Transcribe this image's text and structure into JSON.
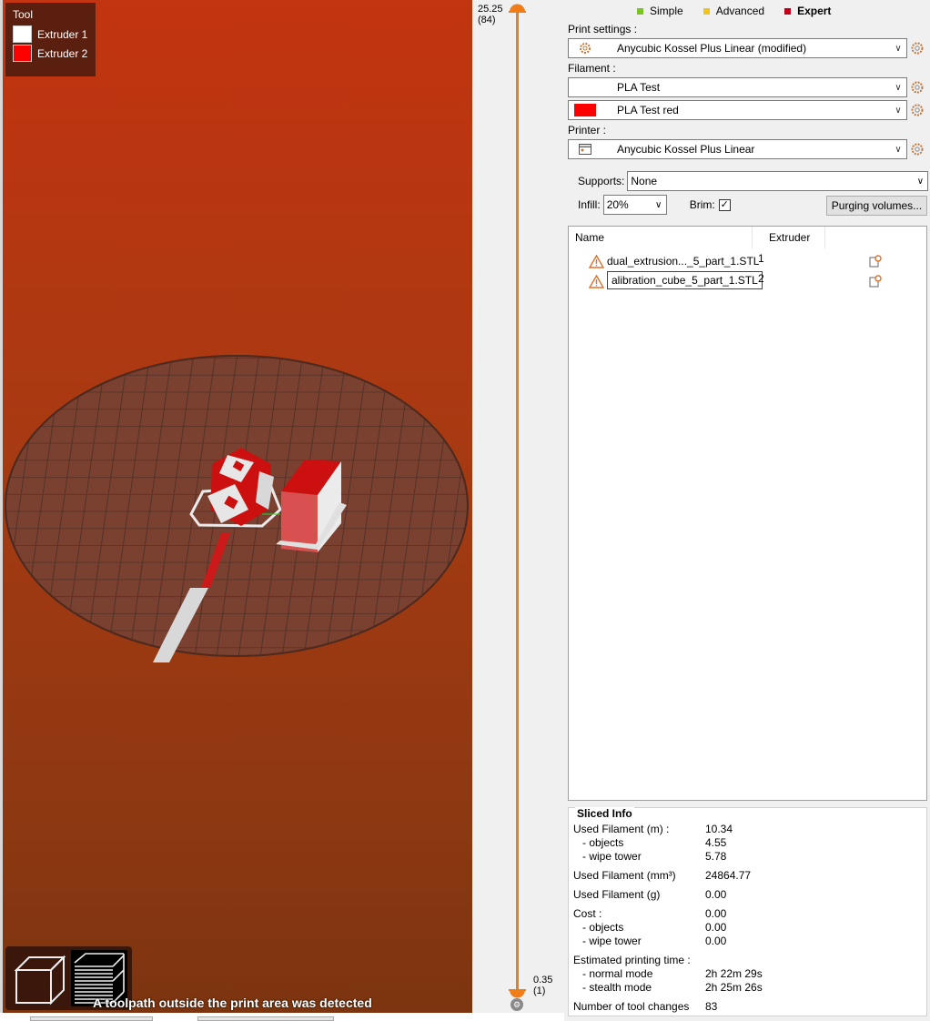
{
  "legend": {
    "title": "Tool",
    "items": [
      {
        "label": "Extruder 1",
        "color": "#ffffff"
      },
      {
        "label": "Extruder 2",
        "color": "#ff0000"
      }
    ]
  },
  "viewport": {
    "warning": "A toolpath outside the print area was detected",
    "view_buttons": [
      "3d-view-icon",
      "layers-view-icon"
    ]
  },
  "layer_slider": {
    "top_value": "25.25",
    "top_layer": "(84)",
    "bottom_value": "0.35",
    "bottom_layer": "(1)",
    "accent": "#f07d17"
  },
  "modes": [
    {
      "label": "Simple",
      "color": "#7bc425",
      "active": false
    },
    {
      "label": "Advanced",
      "color": "#f2c418",
      "active": false
    },
    {
      "label": "Expert",
      "color": "#c0001b",
      "active": true
    }
  ],
  "print_settings": {
    "label": "Print settings :",
    "value": "Anycubic Kossel Plus Linear (modified)"
  },
  "filament": {
    "label": "Filament :",
    "items": [
      {
        "value": "PLA Test",
        "color": ""
      },
      {
        "value": "PLA Test red",
        "color": "#ff0000"
      }
    ]
  },
  "printer": {
    "label": "Printer :",
    "value": "Anycubic Kossel Plus Linear"
  },
  "supports": {
    "label": "Supports:",
    "value": "None"
  },
  "infill": {
    "label": "Infill:",
    "value": "20%"
  },
  "brim": {
    "label": "Brim:",
    "checked": true,
    "mark": "✓"
  },
  "purging_button": "Purging volumes...",
  "object_list": {
    "columns": [
      "Name",
      "Extruder"
    ],
    "rows": [
      {
        "name": "dual_extrusion..._5_part_1.STL",
        "extruder": "1",
        "editing": false
      },
      {
        "name": "alibration_cube_5_part_1.STL",
        "extruder": "2",
        "editing": true
      }
    ]
  },
  "sliced_info": {
    "title": "Sliced Info",
    "rows": [
      {
        "label": "Used Filament (m) :",
        "value": "10.34"
      },
      {
        "label": "   - objects",
        "value": "4.55"
      },
      {
        "label": "   - wipe tower",
        "value": "5.78"
      },
      {
        "label": "Used Filament (mm³)",
        "value": "24864.77"
      },
      {
        "label": "Used Filament (g)",
        "value": "0.00"
      },
      {
        "label": "Cost :",
        "value": "0.00"
      },
      {
        "label": "   - objects",
        "value": "0.00"
      },
      {
        "label": "   - wipe tower",
        "value": "0.00"
      },
      {
        "label": "Estimated printing time :",
        "value": ""
      },
      {
        "label": "   - normal mode",
        "value": "2h 22m 29s"
      },
      {
        "label": "   - stealth mode",
        "value": "2h 25m 26s"
      },
      {
        "label": "Number of tool changes",
        "value": "83"
      }
    ]
  }
}
